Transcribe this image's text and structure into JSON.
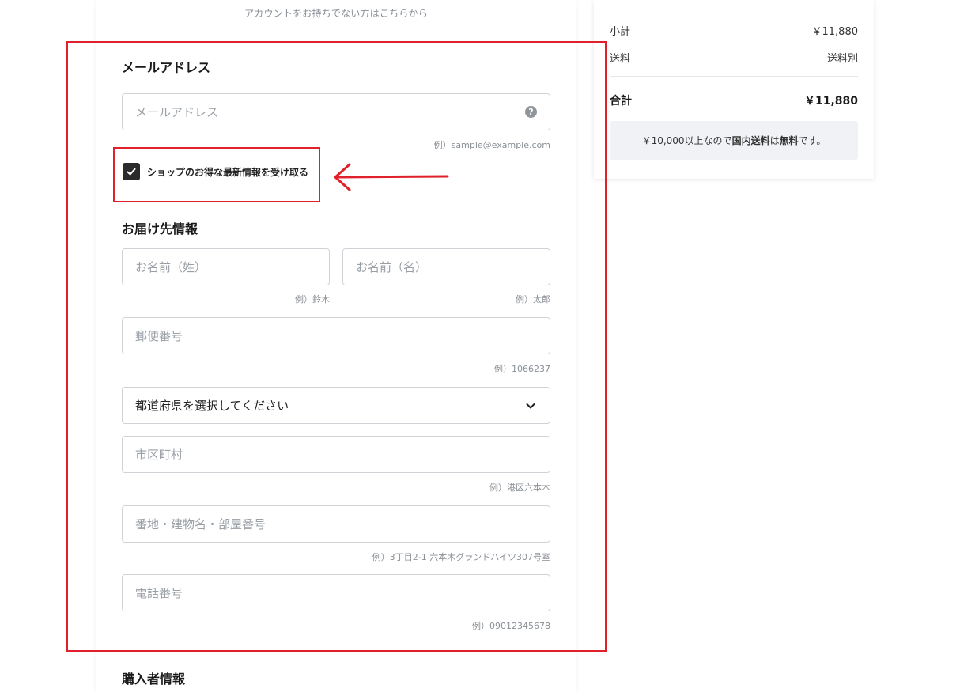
{
  "divider_text": "アカウントをお持ちでない方はこちらから",
  "email_section": {
    "heading": "メールアドレス",
    "placeholder": "メールアドレス",
    "hint": "例）sample@example.com",
    "help_icon": "question-circle-icon"
  },
  "newsletter": {
    "label": "ショップのお得な最新情報を受け取る",
    "checked": true
  },
  "shipping_section": {
    "heading": "お届け先情報",
    "last_name": {
      "placeholder": "お名前（姓）",
      "hint": "例）鈴木"
    },
    "first_name": {
      "placeholder": "お名前（名）",
      "hint": "例）太郎"
    },
    "postal_code": {
      "placeholder": "郵便番号",
      "hint": "例）1066237"
    },
    "prefecture": {
      "selected": "都道府県を選択してください"
    },
    "city": {
      "placeholder": "市区町村",
      "hint": "例）港区六本木"
    },
    "address": {
      "placeholder": "番地・建物名・部屋番号",
      "hint": "例）3丁目2-1 六本木グランドハイツ307号室"
    },
    "phone": {
      "placeholder": "電話番号",
      "hint": "例）09012345678"
    }
  },
  "buyer_section": {
    "heading": "購入者情報"
  },
  "summary": {
    "subtotal_label": "小計",
    "subtotal_value": "￥11,880",
    "shipping_label": "送料",
    "shipping_value": "送料別",
    "total_label": "合計",
    "total_value": "￥11,880",
    "notice_pre": "￥10,000以上なので",
    "notice_bold1": "国内送料",
    "notice_mid": "は",
    "notice_bold2": "無料",
    "notice_post": "です。"
  },
  "colors": {
    "annotation_red": "#e0202a",
    "checkbox_fill": "#2b2b2b",
    "notice_bg": "#f0f2f6"
  }
}
